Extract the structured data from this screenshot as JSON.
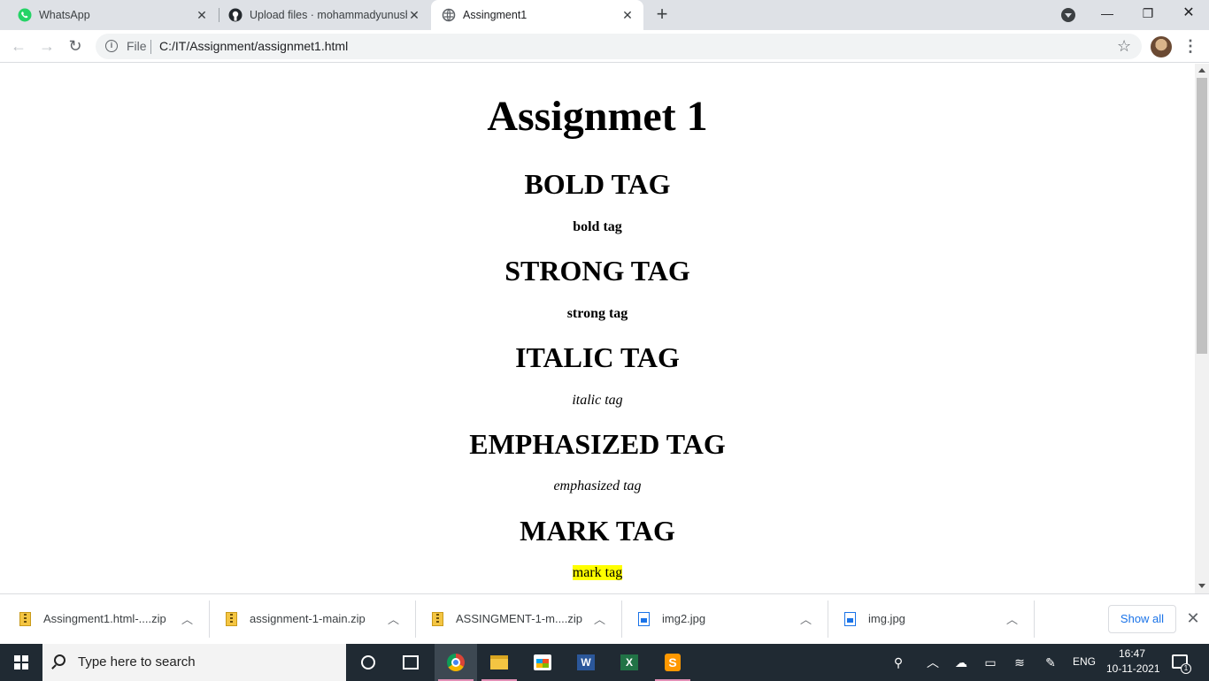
{
  "browser": {
    "tabs": [
      {
        "title": "WhatsApp",
        "icon": "whatsapp-icon",
        "active": false
      },
      {
        "title": "Upload files · mohammadyunush",
        "icon": "github-icon",
        "active": false
      },
      {
        "title": "Assingment1",
        "icon": "globe-icon",
        "active": true
      }
    ],
    "new_tab": "+",
    "address": {
      "scheme_label": "File",
      "url": "C:/IT/Assignment/assignmet1.html"
    }
  },
  "page": {
    "title": "Assignmet 1",
    "sections": [
      {
        "heading": "BOLD TAG",
        "text": "bold tag",
        "style": "bold"
      },
      {
        "heading": "STRONG TAG",
        "text": "strong tag",
        "style": "strong"
      },
      {
        "heading": "ITALIC TAG",
        "text": "italic tag",
        "style": "italic"
      },
      {
        "heading": "EMPHASIZED TAG",
        "text": "emphasized tag",
        "style": "em"
      },
      {
        "heading": "MARK TAG",
        "text": "mark tag",
        "style": "mark"
      }
    ],
    "mark_color": "#ffff00"
  },
  "downloads": {
    "items": [
      {
        "name": "Assingment1.html-....zip",
        "type": "zip"
      },
      {
        "name": "assignment-1-main.zip",
        "type": "zip"
      },
      {
        "name": "ASSINGMENT-1-m....zip",
        "type": "zip"
      },
      {
        "name": "img2.jpg",
        "type": "jpg"
      },
      {
        "name": "img.jpg",
        "type": "jpg"
      }
    ],
    "show_all": "Show all"
  },
  "taskbar": {
    "search_placeholder": "Type here to search",
    "language": "ENG",
    "time": "16:47",
    "date": "10-11-2021",
    "notification_count": "1",
    "pinned": [
      "cortana",
      "task-view",
      "chrome",
      "file-explorer",
      "store",
      "word",
      "excel",
      "sublime-text"
    ]
  }
}
